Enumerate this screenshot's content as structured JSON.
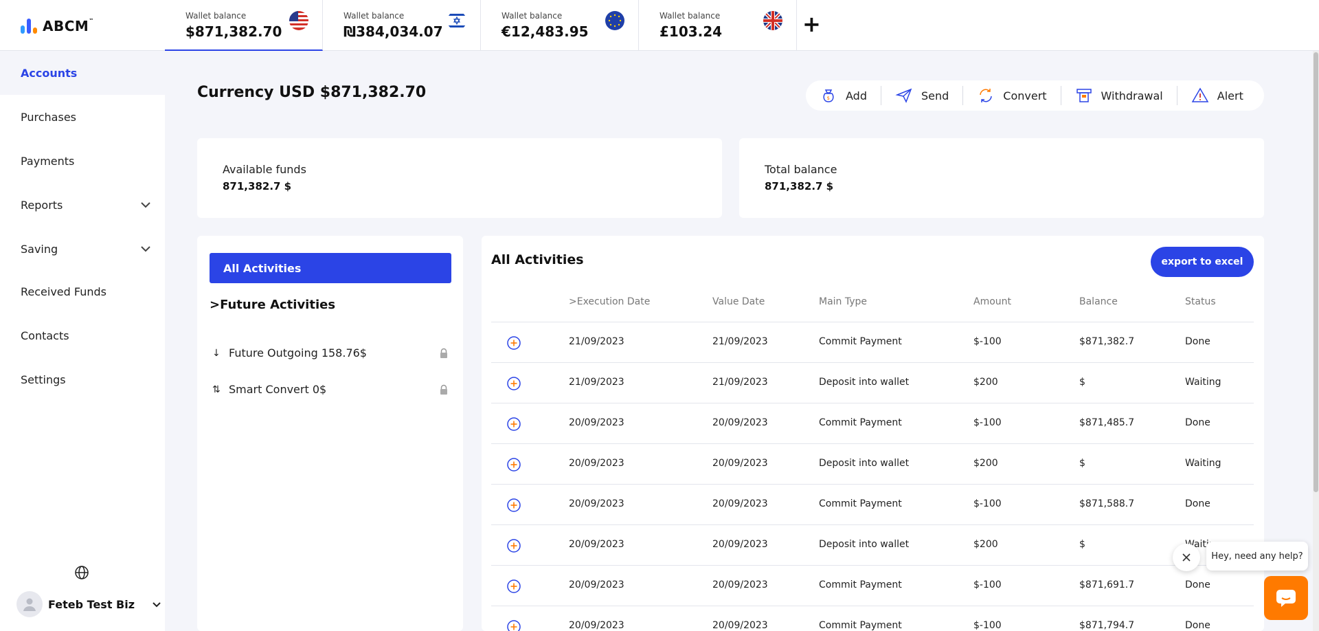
{
  "brand": {
    "name": "ABCM",
    "tm": "™"
  },
  "wallets": [
    {
      "label": "Wallet balance",
      "amount": "$871,382.70",
      "flag": "us-flag-icon"
    },
    {
      "label": "Wallet balance",
      "amount": "₪384,034.07",
      "flag": "israel-flag-icon"
    },
    {
      "label": "Wallet balance",
      "amount": "€12,483.95",
      "flag": "eu-flag-icon"
    },
    {
      "label": "Wallet balance",
      "amount": "£103.24",
      "flag": "uk-flag-icon"
    }
  ],
  "add_wallet": "+",
  "sidebar": {
    "items": [
      {
        "label": "Accounts"
      },
      {
        "label": "Purchases"
      },
      {
        "label": "Payments"
      },
      {
        "label": "Reports"
      },
      {
        "label": "Saving"
      },
      {
        "label": "Received Funds"
      },
      {
        "label": "Contacts"
      },
      {
        "label": "Settings"
      }
    ],
    "user": "Feteb Test Biz"
  },
  "page": {
    "title": "Currency USD $871,382.70"
  },
  "actions": {
    "add": "Add",
    "send": "Send",
    "convert": "Convert",
    "withdrawal": "Withdrawal",
    "alert": "Alert"
  },
  "cards": {
    "available_label": "Available funds",
    "available_value": "871,382.7 $",
    "total_label": "Total balance",
    "total_value": "871,382.7 $"
  },
  "activity_panel": {
    "tab_all": "All Activities",
    "future_heading": ">Future Activities",
    "future_rows": [
      {
        "arrow": "↓",
        "label": "Future Outgoing 158.76$"
      },
      {
        "arrow": "⇅",
        "label": "Smart Convert 0$"
      }
    ]
  },
  "table": {
    "title": "All Activities",
    "export_label": "export to excel",
    "headers": [
      ">Execution Date",
      "Value Date",
      "Main Type",
      "Amount",
      "Balance",
      "Status"
    ],
    "rows": [
      [
        "21/09/2023",
        "21/09/2023",
        "Commit Payment",
        "$-100",
        "$871,382.7",
        "Done"
      ],
      [
        "21/09/2023",
        "21/09/2023",
        "Deposit into wallet",
        "$200",
        "$",
        "Waiting"
      ],
      [
        "20/09/2023",
        "20/09/2023",
        "Commit Payment",
        "$-100",
        "$871,485.7",
        "Done"
      ],
      [
        "20/09/2023",
        "20/09/2023",
        "Deposit into wallet",
        "$200",
        "$",
        "Waiting"
      ],
      [
        "20/09/2023",
        "20/09/2023",
        "Commit Payment",
        "$-100",
        "$871,588.7",
        "Done"
      ],
      [
        "20/09/2023",
        "20/09/2023",
        "Deposit into wallet",
        "$200",
        "$",
        "Waitin"
      ],
      [
        "20/09/2023",
        "20/09/2023",
        "Commit Payment",
        "$-100",
        "$871,691.7",
        "Done"
      ],
      [
        "20/09/2023",
        "20/09/2023",
        "Commit Payment",
        "$-100",
        "$871,794.7",
        "Done"
      ]
    ]
  },
  "help": {
    "text": "Hey, need any help?"
  },
  "colors": {
    "accent": "#2b44e6",
    "orange": "#ff7a00"
  }
}
